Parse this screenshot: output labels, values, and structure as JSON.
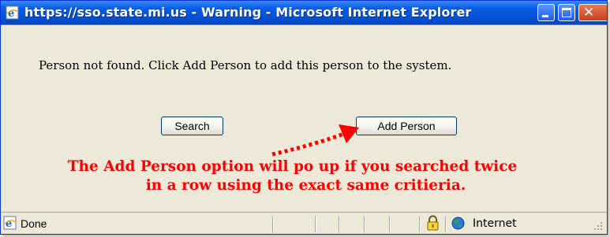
{
  "window": {
    "title": "https://sso.state.mi.us - Warning - Microsoft Internet Explorer",
    "minimize_icon": "minimize-icon",
    "maximize_icon": "maximize-icon",
    "close_icon": "close-icon",
    "close_glyph": "✕"
  },
  "dialog": {
    "message": "Person not found. Click Add Person to add this person to the system.",
    "search_label": "Search",
    "add_person_label": "Add Person"
  },
  "annotation": {
    "line1": "The Add Person option will po up if you searched twice",
    "line2": "in a row using the exact same critieria.",
    "color": "#ff0000"
  },
  "statusbar": {
    "status": "Done",
    "zone": "Internet",
    "page_icon": "ie-page-icon",
    "lock_icon": "lock-icon",
    "zone_icon": "globe-icon"
  },
  "colors": {
    "titlebar": "#0554d9",
    "face": "#ece9d8",
    "accent_red": "#ff0000"
  }
}
